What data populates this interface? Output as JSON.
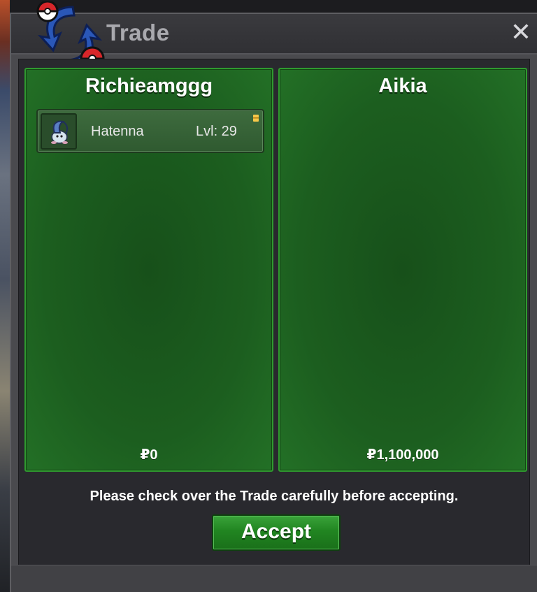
{
  "window": {
    "title": "Trade",
    "close_glyph": "✕"
  },
  "left_panel": {
    "player_name": "Richieamggg",
    "money": "₽0",
    "items": [
      {
        "name": "Hatenna",
        "level": "Lvl: 29",
        "icon": "pokemon-sprite-icon"
      }
    ]
  },
  "right_panel": {
    "player_name": "Aikia",
    "money": "₽1,100,000"
  },
  "footer": {
    "notice": "Please check over the Trade carefully before accepting.",
    "accept_label": "Accept"
  },
  "colors": {
    "panel_green": "#1c5e1f",
    "panel_border": "#2f9a2f",
    "button_green": "#218521",
    "window_bg": "#29292e"
  }
}
